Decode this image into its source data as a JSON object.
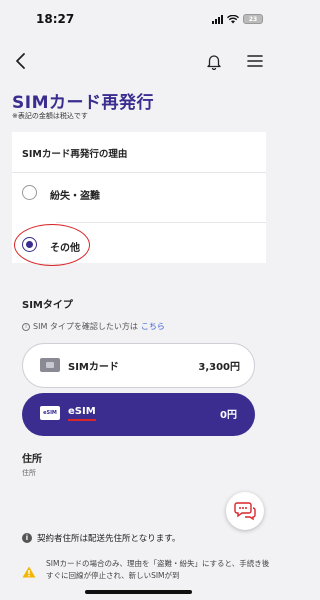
{
  "status_bar": {
    "time": "18:27",
    "battery": "23"
  },
  "page": {
    "title": "SIMカード再発行",
    "tax_note": "※表記の金額は税込です"
  },
  "reason": {
    "heading": "SIMカード再発行の理由",
    "options": [
      {
        "label": "紛失・盗難",
        "selected": false
      },
      {
        "label": "その他",
        "selected": true
      }
    ]
  },
  "sim_type": {
    "heading": "SIMタイプ",
    "info_prefix": "SIM タイプを確認したい方は",
    "info_link": "こちら",
    "options": [
      {
        "label": "SIMカード",
        "price": "3,300円",
        "selected": false
      },
      {
        "label": "eSIM",
        "icon_text": "eSIM",
        "price": "0円",
        "selected": true
      }
    ]
  },
  "address": {
    "heading": "住所",
    "label": "住所",
    "note": "契約者住所は配送先住所となります。"
  },
  "warning": {
    "text": "SIMカードの場合のみ、理由を「盗難・紛失」にすると、手続き後すぐに回線が停止され、新しいSIMが到"
  },
  "colors": {
    "accent": "#3a2d8f",
    "highlight": "#d9262a",
    "link": "#3a5fd0"
  }
}
